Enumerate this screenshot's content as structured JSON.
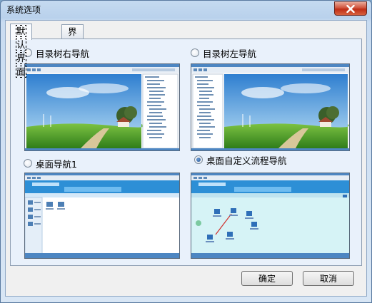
{
  "window": {
    "title": "系统选项"
  },
  "tabs": [
    {
      "label": "默认界面",
      "active": true
    },
    {
      "label": "界面风格",
      "active": false
    }
  ],
  "options": [
    {
      "label": "目录树右导航",
      "checked": false,
      "preview": "tree-right-nav"
    },
    {
      "label": "目录树左导航",
      "checked": false,
      "preview": "tree-left-nav"
    },
    {
      "label": "桌面导航1",
      "checked": false,
      "preview": "desktop-nav"
    },
    {
      "label": "桌面自定义流程导航",
      "checked": true,
      "preview": "desktop-custom-flow-nav"
    }
  ],
  "buttons": {
    "ok": "确定",
    "cancel": "取消"
  },
  "colors": {
    "accent": "#3c6fb0",
    "close": "#c9412a",
    "panel": "#e9f1fb",
    "sky": "#4a98d8",
    "grass": "#4e9e2c"
  },
  "icons": {
    "close": "close-icon"
  }
}
